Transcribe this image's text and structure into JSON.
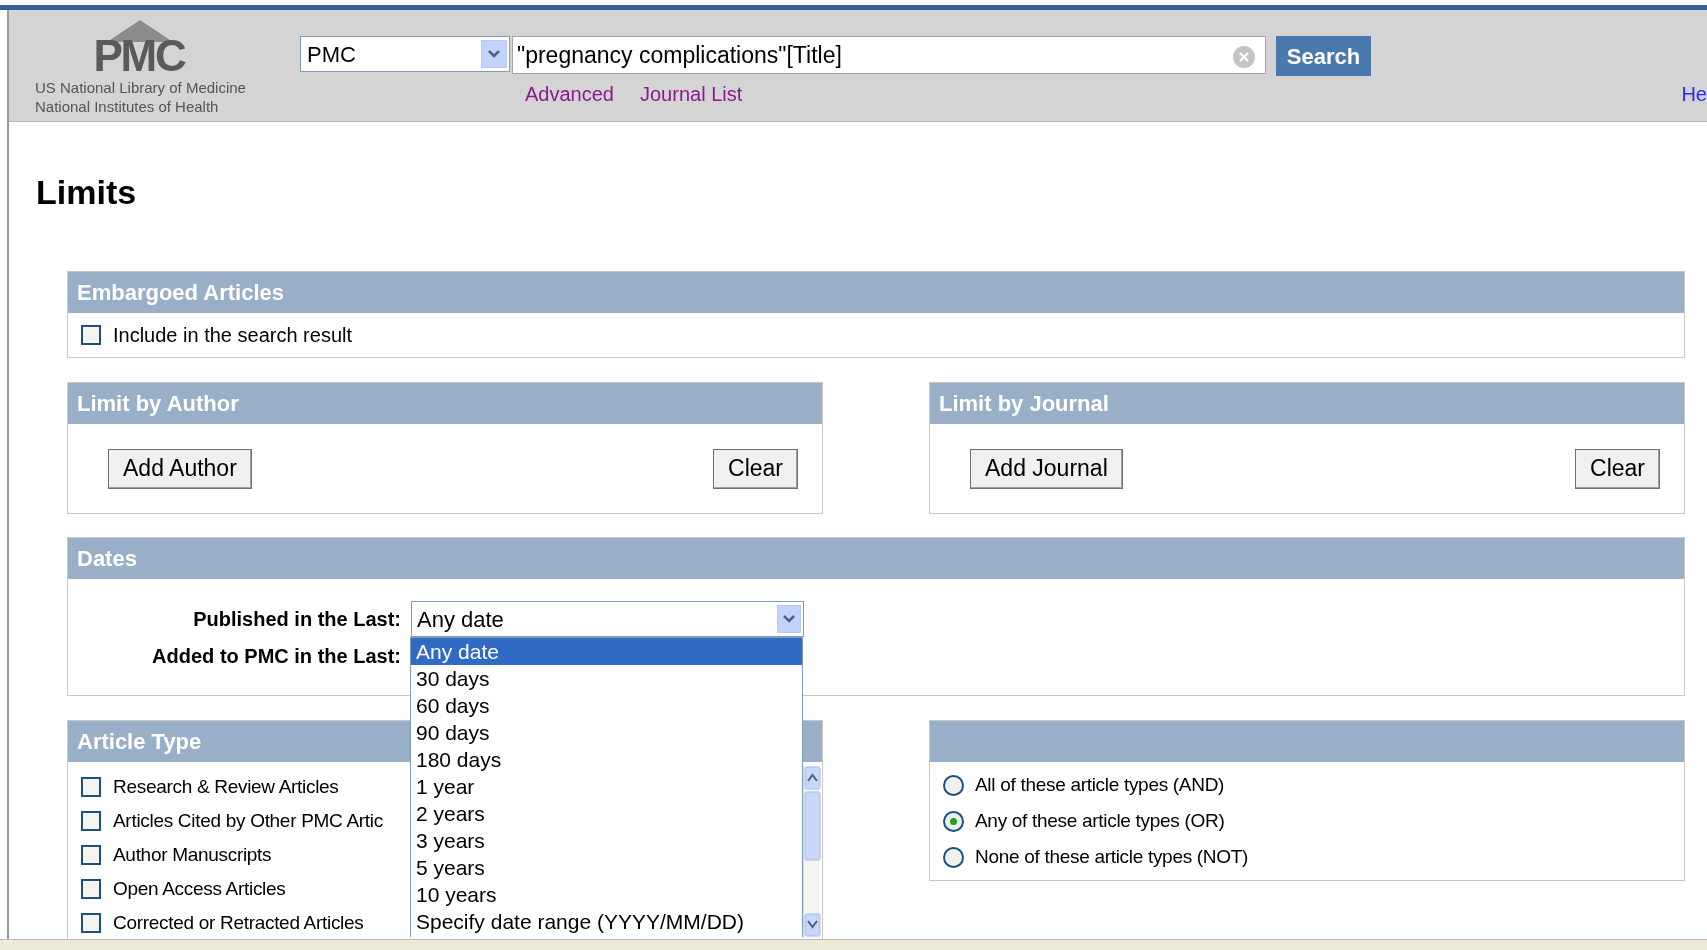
{
  "header": {
    "logo": {
      "title": "PMC",
      "line_1": "US National Library of Medicine",
      "line_2": "National Institutes of Health"
    },
    "database_select": "PMC",
    "search_field": {
      "value": "\"pregnancy complications\"[Title]"
    },
    "search_button": "Search",
    "links": [
      "Advanced",
      "Journal List"
    ],
    "help_link": "He"
  },
  "page_title": "Limits",
  "embargoed": {
    "title": "Embargoed Articles",
    "checkbox": {
      "label": "Include in the search result",
      "checked": false
    }
  },
  "author": {
    "title": "Limit by Author",
    "add_button": "Add Author",
    "clear_button": "Clear"
  },
  "journal": {
    "title": "Limit by Journal",
    "add_button": "Add Journal",
    "clear_button": "Clear"
  },
  "dates": {
    "title": "Dates",
    "fields": [
      {
        "label": "Published in the Last:",
        "value": "Any date"
      },
      {
        "label": "Added to PMC in the Last:"
      }
    ],
    "dropdown": {
      "options": [
        {
          "label": "Any date",
          "selected": true
        },
        {
          "label": "30 days",
          "selected": false
        },
        {
          "label": "60 days",
          "selected": false
        },
        {
          "label": "90 days",
          "selected": false
        },
        {
          "label": "180 days",
          "selected": false
        },
        {
          "label": "1 year",
          "selected": false
        },
        {
          "label": "2 years",
          "selected": false
        },
        {
          "label": "3 years",
          "selected": false
        },
        {
          "label": "5 years",
          "selected": false
        },
        {
          "label": "10 years",
          "selected": false
        },
        {
          "label": "Specify date range (YYYY/MM/DD)",
          "selected": false
        }
      ]
    }
  },
  "article_type": {
    "title": "Article Type",
    "items": [
      {
        "label": "Research & Review Articles",
        "checked": false
      },
      {
        "label": "Articles Cited by Other PMC Artic",
        "checked": false
      },
      {
        "label": "Author Manuscripts",
        "checked": false
      },
      {
        "label": "Open Access Articles",
        "checked": false
      },
      {
        "label": "Corrected or Retracted Articles",
        "checked": false
      }
    ]
  },
  "combine": {
    "options": [
      {
        "label": "All of these article types (AND)",
        "selected": false
      },
      {
        "label": "Any of these article types (OR)",
        "selected": true
      },
      {
        "label": "None of these article types (NOT)",
        "selected": false
      }
    ]
  }
}
